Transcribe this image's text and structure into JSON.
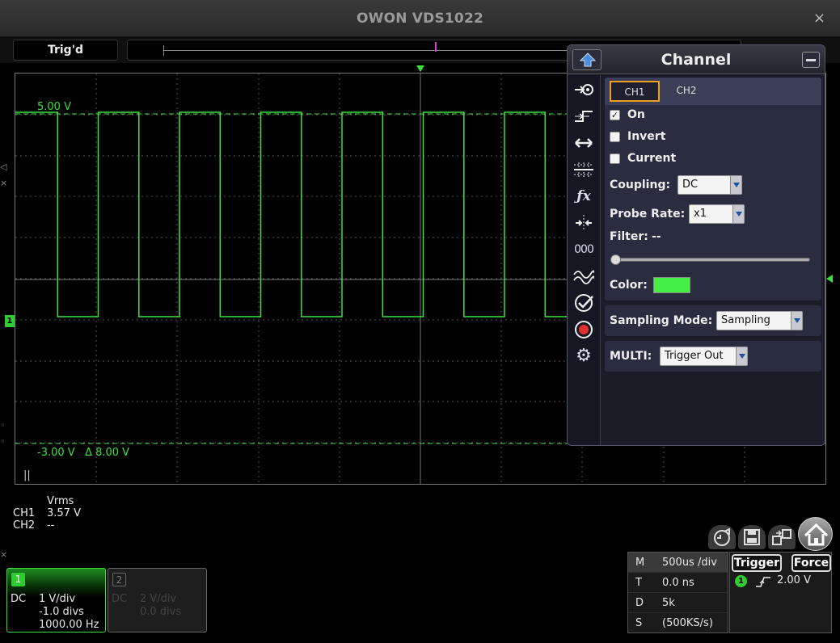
{
  "window": {
    "title": "OWON VDS1022",
    "close": "×"
  },
  "toolbar": {
    "trigger_status": "Trig'd"
  },
  "screen": {
    "cursor_top": "5.00 V",
    "cursor_bottom": "-3.00 V",
    "cursor_delta": "Δ 8.00 V",
    "ch1_marker": "1",
    "pause": "||"
  },
  "measurements": {
    "header": "Vrms",
    "rows": [
      {
        "channel": "CH1",
        "value": "3.57 V"
      },
      {
        "channel": "CH2",
        "value": "--"
      }
    ]
  },
  "panel": {
    "title": "Channel",
    "tabs": [
      "CH1",
      "CH2"
    ],
    "active_tab": "CH1",
    "options": [
      {
        "label": "On",
        "checked": true
      },
      {
        "label": "Invert",
        "checked": false
      },
      {
        "label": "Current",
        "checked": false
      }
    ],
    "coupling_label": "Coupling:",
    "coupling_value": "DC",
    "probe_label": "Probe Rate:",
    "probe_value": "x1",
    "filter_label": "Filter:",
    "filter_value": "--",
    "color_label": "Color:",
    "color_value": "#44ee44",
    "sampling_label": "Sampling Mode:",
    "sampling_value": "Sampling",
    "multi_label": "MULTI:",
    "multi_value": "Trigger Out",
    "side_icons": [
      "channel-icon",
      "trigger-icon",
      "horizontal-icon",
      "display-icon",
      "math-icon",
      "cursor-icon",
      "measure-icon",
      "reference-icon",
      "pass-fail-icon",
      "record-icon",
      "settings-icon"
    ]
  },
  "ch1_box": {
    "num": "1",
    "coupling": "DC",
    "vdiv": "1 V/div",
    "offset": "-1.0 divs",
    "freq": "1000.00 Hz"
  },
  "ch2_box": {
    "num": "2",
    "coupling": "DC",
    "vdiv": "2 V/div",
    "offset": "0.0 divs"
  },
  "timebase": [
    {
      "k": "M",
      "v": "500us /div"
    },
    {
      "k": "T",
      "v": "0.0 ns"
    },
    {
      "k": "D",
      "v": "5k"
    },
    {
      "k": "S",
      "v": "(500KS/s)"
    }
  ],
  "trigger": {
    "trigger_label": "Trigger",
    "force_label": "Force",
    "source": "1",
    "level": "2.00 V"
  },
  "colors": {
    "trace": "#3ee03e",
    "accent": "#f0a020",
    "panel_bg": "#1a1c28"
  }
}
